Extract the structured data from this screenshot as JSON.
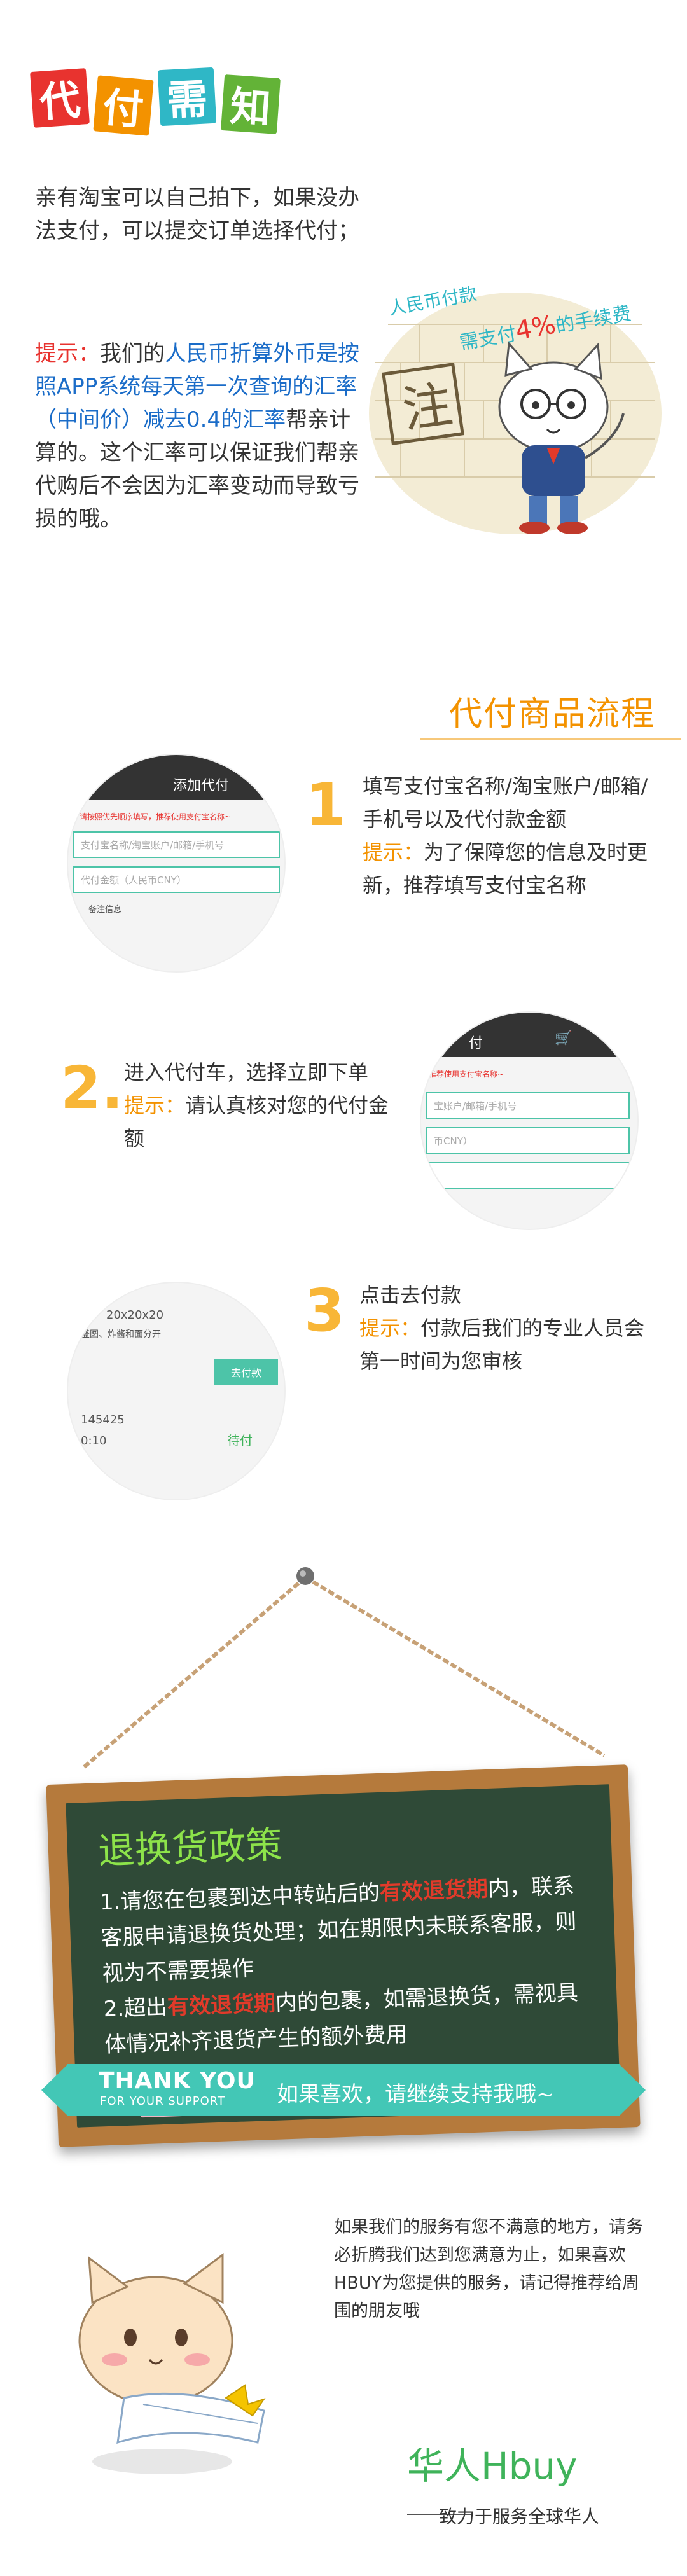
{
  "title": {
    "chars": [
      "代",
      "付",
      "需",
      "知"
    ],
    "colors": [
      "#e8332f",
      "#f39200",
      "#2fb7c6",
      "#63b337"
    ]
  },
  "intro": "亲有淘宝可以自己拍下，如果没办法支付，可以提交订单选择代付；",
  "tip": {
    "label": "提示：",
    "p1": "我们的",
    "p2": "人民币折算外币是按照APP系统每天第一次查询的汇率（中间价）减去0.4的汇率",
    "p3": "帮亲计算的。这个汇率可以保证我们帮亲代购后不会因为汇率变动而导致亏损的哦。"
  },
  "mascot_bubble": {
    "line1": "人民币付款",
    "line2a": "需支付",
    "line2b": "4%",
    "line2c": "的手续费",
    "stamp": "注"
  },
  "flow": {
    "heading": "代付商品流程",
    "step1": {
      "num": "1",
      "text": "填写支付宝名称/淘宝账户/邮箱/手机号以及代付款金额",
      "tip_label": "提示：",
      "tip": "为了保障您的信息及时更新，推荐填写支付宝名称",
      "shot_title": "添加代付",
      "shot_warning": "请按照优先顺序填写，推荐使用支付宝名称~",
      "shot_field1": "支付宝名称/淘宝账户/邮箱/手机号",
      "shot_field2": "代付金额（人民币CNY）",
      "shot_note": "备注信息"
    },
    "step2": {
      "num": "2.",
      "text": "进入代付车，选择立即下单",
      "tip_label": "提示：",
      "tip": "请认真核对您的代付金额",
      "shot_title": "付",
      "shot_warning": "推荐使用支付宝名称~",
      "shot_field1": "宝账户/邮箱/手机号",
      "shot_field2": "币CNY）"
    },
    "step3": {
      "num": "3",
      "text": "点击去付款",
      "tip_label": "提示：",
      "tip": "付款后我们的专业人员会第一时间为您审核",
      "shot_line1": "20x20x20",
      "shot_line2": "盛图、炸酱和面分开",
      "shot_button": "去付款",
      "shot_line3": "145425",
      "shot_line4": "0:10",
      "shot_status": "待付"
    }
  },
  "board": {
    "title": "退换货政策",
    "l1a": "1.请您在包裹到达中转站后的",
    "l1b": "有效退货期",
    "l1c": "内，联系客服申请退换货处理；如在期限内未联系客服，则视为不需要操作",
    "l2a": "2.超出",
    "l2b": "有效退货期",
    "l2c": "内的包裹，如需退换货，需视具体情况补齐退货产生的额外费用"
  },
  "banner": {
    "thank": "THANK YOU",
    "support": "FOR YOUR SUPPORT",
    "msg": "如果喜欢，请继续支持我哦~"
  },
  "footer": {
    "text": "如果我们的服务有您不满意的地方，请务必折腾我们达到您满意为止，如果喜欢HBUY为您提供的服务，请记得推荐给周围的朋友哦",
    "brand": "华人Hbuy",
    "slogan": "致力于服务全球华人"
  }
}
